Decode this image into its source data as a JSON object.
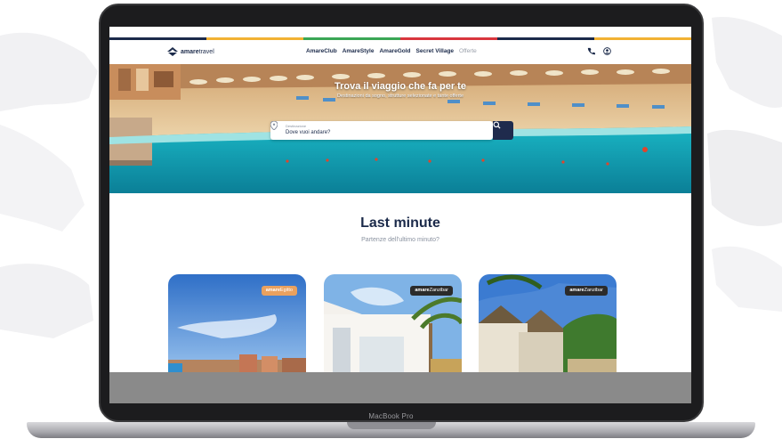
{
  "device": {
    "chin_label": "MacBook Pro"
  },
  "site": {
    "logo": {
      "brand": "amare",
      "suffix": "travel"
    },
    "nav": [
      "AmareClub",
      "AmareStyle",
      "AmareGold",
      "Secret Village"
    ],
    "nav_muted": "Offerte",
    "icons": [
      "phone-icon",
      "user-icon"
    ],
    "strip_colors": [
      "#1b2a4a",
      "#f2b233",
      "#3aa655",
      "#d9363e",
      "#1b2a4a",
      "#f2b233"
    ]
  },
  "hero": {
    "title": "Trova il viaggio che fa per te",
    "subtitle": "Destinazioni da sogno, strutture selezionate e tante offerte",
    "search": {
      "label": "Destinazione",
      "placeholder": "Dove vuoi andare?"
    }
  },
  "last_minute": {
    "title": "Last minute",
    "subtitle": "Partenze dell'ultimo minuto?",
    "cards": [
      {
        "badge_brand": "amare",
        "badge_name": "Egitto",
        "badge_color": "#e9a15f"
      },
      {
        "badge_brand": "amare",
        "badge_name": "Zanzibar",
        "badge_color": "#2b2b2b"
      },
      {
        "badge_brand": "amare",
        "badge_name": "Zanzibar",
        "badge_color": "#2b2b2b"
      }
    ]
  }
}
